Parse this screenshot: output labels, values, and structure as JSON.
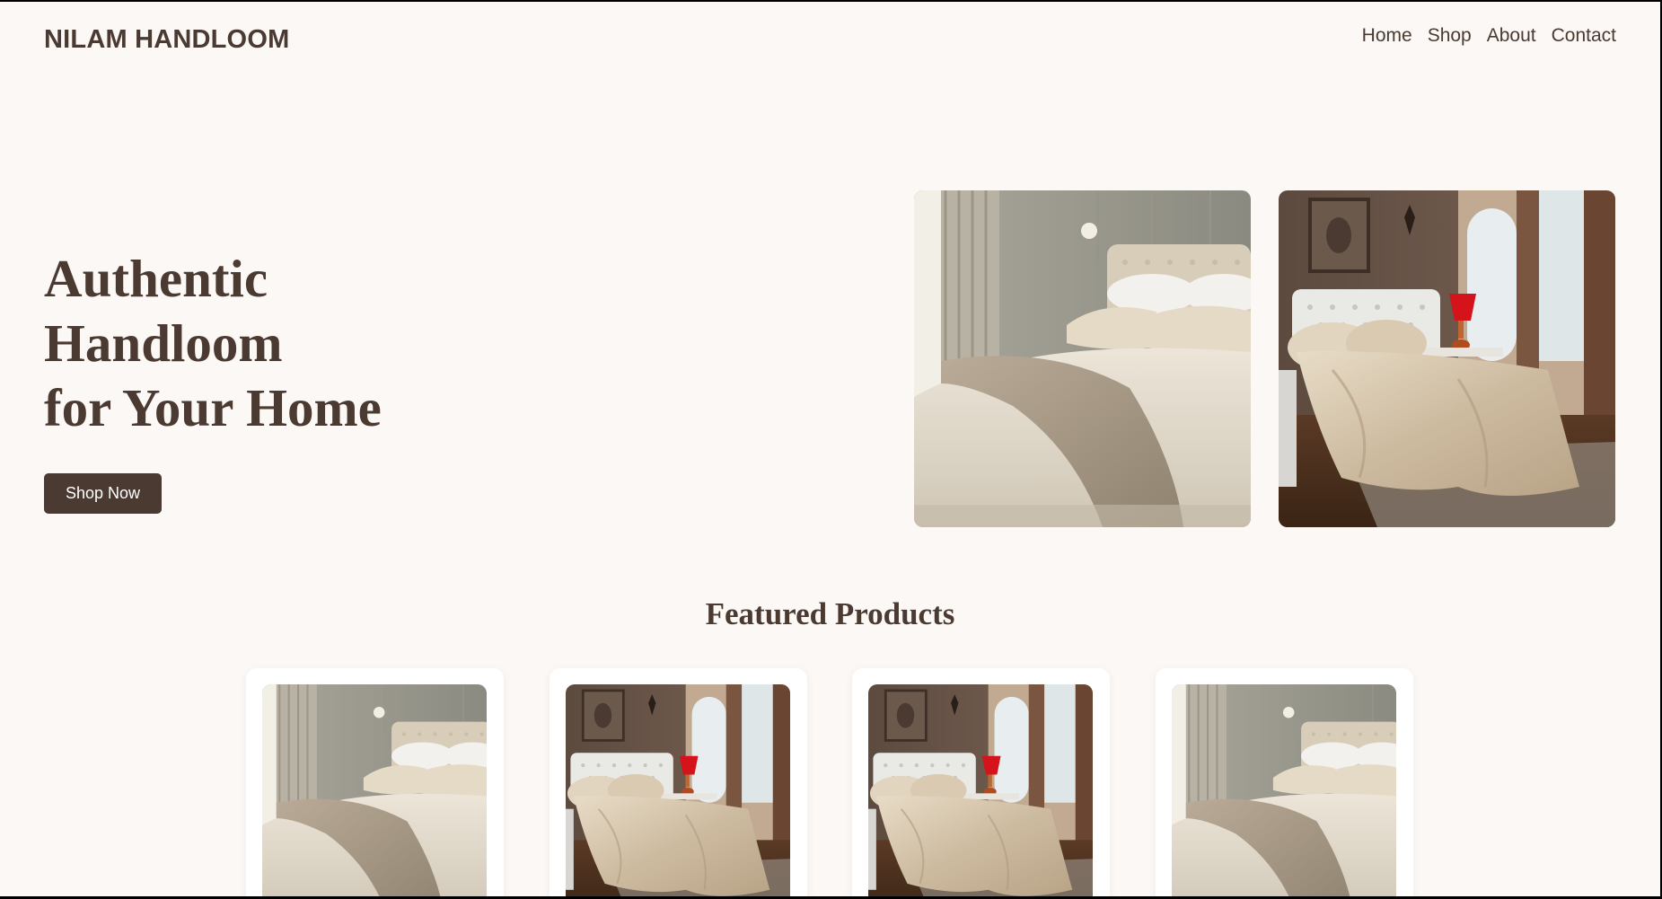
{
  "header": {
    "brand": "NILAM HANDLOOM",
    "nav": [
      {
        "label": "Home"
      },
      {
        "label": "Shop"
      },
      {
        "label": "About"
      },
      {
        "label": "Contact"
      }
    ]
  },
  "hero": {
    "title_lines": [
      "Authentic",
      "Handloom",
      "for Your Home"
    ],
    "cta_label": "Shop Now",
    "images": [
      {
        "kind": "bedroom-linen-photo"
      },
      {
        "kind": "bedroom-satin-photo"
      }
    ]
  },
  "featured": {
    "title": "Featured Products",
    "products": [
      {
        "image": "bedroom-linen-photo"
      },
      {
        "image": "bedroom-satin-photo"
      },
      {
        "image": "bedroom-satin-photo"
      },
      {
        "image": "bedroom-linen-photo"
      }
    ]
  },
  "colors": {
    "page_background": "#fcf8f5",
    "brand_brown": "#4a3a31",
    "button_text": "#ffffff"
  }
}
